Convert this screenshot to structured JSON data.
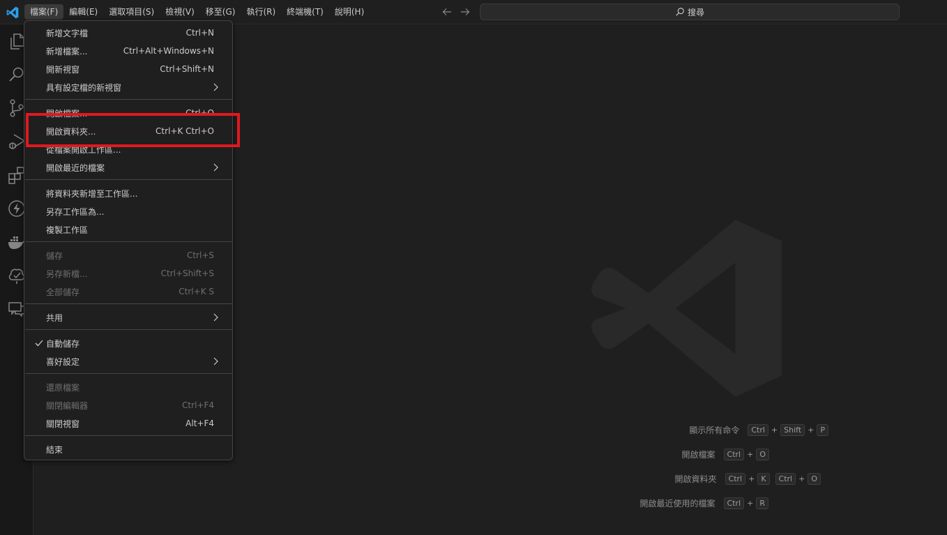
{
  "menubar": {
    "items": [
      "檔案(F)",
      "編輯(E)",
      "選取項目(S)",
      "檢視(V)",
      "移至(G)",
      "執行(R)",
      "終端機(T)",
      "說明(H)"
    ]
  },
  "search": {
    "label": "搜尋"
  },
  "file_menu": {
    "items": [
      {
        "label": "新增文字檔",
        "accel": "Ctrl+N"
      },
      {
        "label": "新增檔案...",
        "accel": "Ctrl+Alt+Windows+N"
      },
      {
        "label": "開新視窗",
        "accel": "Ctrl+Shift+N"
      },
      {
        "label": "具有設定檔的新視窗",
        "accel": ""
      },
      {
        "label": "開啟檔案...",
        "accel": "Ctrl+O"
      },
      {
        "label": "開啟資料夾...",
        "accel": "Ctrl+K Ctrl+O"
      },
      {
        "label": "從檔案開啟工作區...",
        "accel": ""
      },
      {
        "label": "開啟最近的檔案",
        "accel": ""
      },
      {
        "label": "將資料夾新增至工作區...",
        "accel": ""
      },
      {
        "label": "另存工作區為...",
        "accel": ""
      },
      {
        "label": "複製工作區",
        "accel": ""
      },
      {
        "label": "儲存",
        "accel": "Ctrl+S"
      },
      {
        "label": "另存新檔...",
        "accel": "Ctrl+Shift+S"
      },
      {
        "label": "全部儲存",
        "accel": "Ctrl+K S"
      },
      {
        "label": "共用",
        "accel": ""
      },
      {
        "label": "自動儲存",
        "accel": ""
      },
      {
        "label": "喜好設定",
        "accel": ""
      },
      {
        "label": "還原檔案",
        "accel": ""
      },
      {
        "label": "關閉編輯器",
        "accel": "Ctrl+F4"
      },
      {
        "label": "關閉視窗",
        "accel": "Alt+F4"
      },
      {
        "label": "結束",
        "accel": ""
      }
    ]
  },
  "shortcuts": {
    "show_commands": {
      "label": "顯示所有命令",
      "k1": "Ctrl",
      "k2": "Shift",
      "k3": "P"
    },
    "open_file": {
      "label": "開啟檔案",
      "k1": "Ctrl",
      "k2": "O"
    },
    "open_folder": {
      "label": "開啟資料夾",
      "k1": "Ctrl",
      "k2": "K",
      "k3": "Ctrl",
      "k4": "O"
    },
    "open_recent": {
      "label": "開啟最近使用的檔案",
      "k1": "Ctrl",
      "k2": "R"
    },
    "plus": "+"
  },
  "colors": {
    "accent": "#0078d4",
    "highlight_box": "#e0191f",
    "background": "#1f1f1f"
  }
}
